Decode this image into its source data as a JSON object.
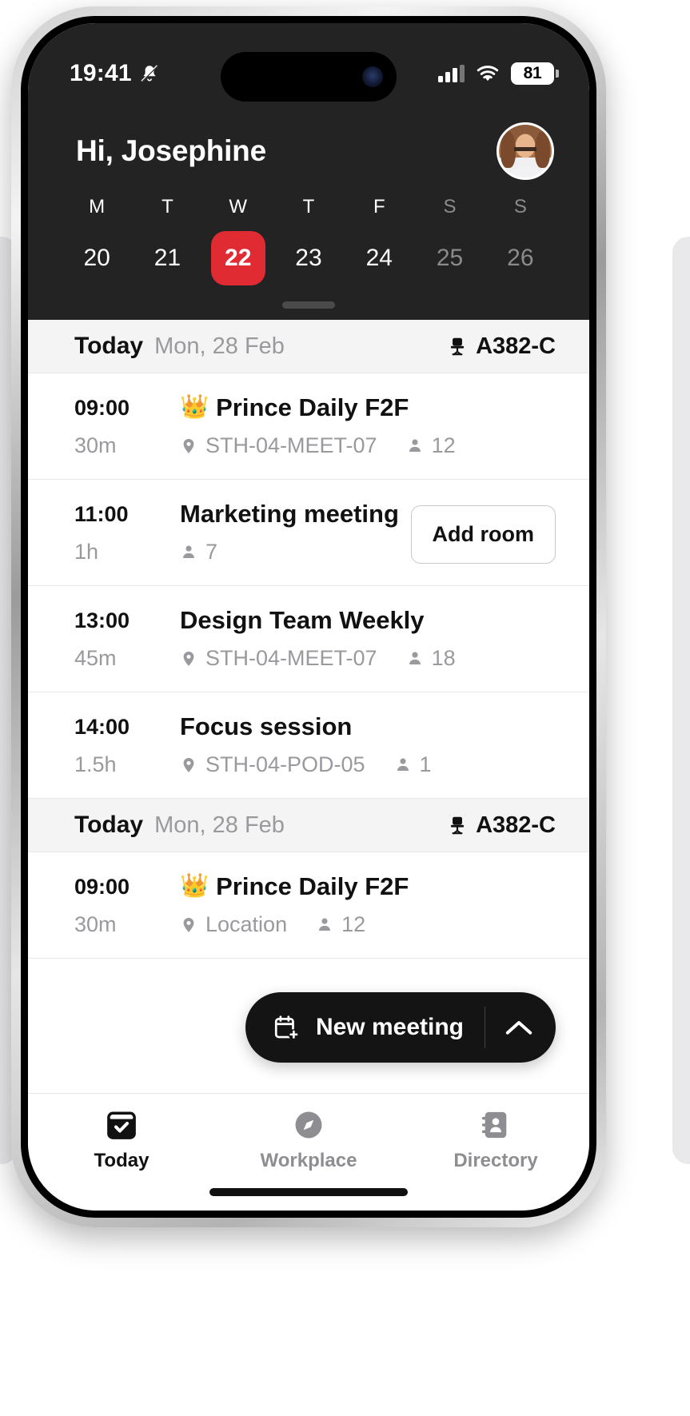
{
  "theme": {
    "accent": "#e02b33",
    "dark_bg": "#232323",
    "fab_bg": "#141414",
    "muted_text": "#9a9a9e"
  },
  "status_bar": {
    "time": "19:41",
    "bell_icon": "bell-muted-icon",
    "signal_icon": "cellular-signal-icon",
    "wifi_icon": "wifi-icon",
    "battery_level": "81"
  },
  "header": {
    "greeting": "Hi, Josephine",
    "avatar_icon": "user-avatar",
    "week": [
      {
        "letter": "M",
        "date": "20",
        "state": "normal"
      },
      {
        "letter": "T",
        "date": "21",
        "state": "normal"
      },
      {
        "letter": "W",
        "date": "22",
        "state": "today"
      },
      {
        "letter": "T",
        "date": "23",
        "state": "normal"
      },
      {
        "letter": "F",
        "date": "24",
        "state": "normal"
      },
      {
        "letter": "S",
        "date": "25",
        "state": "dim"
      },
      {
        "letter": "S",
        "date": "26",
        "state": "dim"
      }
    ]
  },
  "sections": [
    {
      "today_label": "Today",
      "date_label": "Mon, 28 Feb",
      "desk_icon": "office-chair-icon",
      "desk_code": "A382-C",
      "events": [
        {
          "start": "09:00",
          "duration": "30m",
          "emoji": "👑",
          "title": "Prince Daily F2F",
          "location_icon": "location-pin-icon",
          "location": "STH-04-MEET-07",
          "attendee_icon": "person-icon",
          "attendees": "12",
          "action": null
        },
        {
          "start": "11:00",
          "duration": "1h",
          "emoji": "",
          "title": "Marketing meeting",
          "location_icon": "",
          "location": "",
          "attendee_icon": "person-icon",
          "attendees": "7",
          "action": "Add room"
        },
        {
          "start": "13:00",
          "duration": "45m",
          "emoji": "",
          "title": "Design Team Weekly",
          "location_icon": "location-pin-icon",
          "location": "STH-04-MEET-07",
          "attendee_icon": "person-icon",
          "attendees": "18",
          "action": null
        },
        {
          "start": "14:00",
          "duration": "1.5h",
          "emoji": "",
          "title": "Focus session",
          "location_icon": "location-pin-icon",
          "location": "STH-04-POD-05",
          "attendee_icon": "person-icon",
          "attendees": "1",
          "action": null
        }
      ]
    },
    {
      "today_label": "Today",
      "date_label": "Mon, 28 Feb",
      "desk_icon": "office-chair-icon",
      "desk_code": "A382-C",
      "events": [
        {
          "start": "09:00",
          "duration": "30m",
          "emoji": "👑",
          "title": "Prince Daily F2F",
          "location_icon": "location-pin-icon",
          "location": "Location",
          "attendee_icon": "person-icon",
          "attendees": "12",
          "action": null
        }
      ]
    }
  ],
  "fab": {
    "icon": "calendar-plus-icon",
    "label": "New meeting",
    "expand_icon": "chevron-up-icon"
  },
  "tabbar": [
    {
      "icon": "calendar-check-icon",
      "label": "Today",
      "active": true
    },
    {
      "icon": "compass-icon",
      "label": "Workplace",
      "active": false
    },
    {
      "icon": "contact-book-icon",
      "label": "Directory",
      "active": false
    }
  ]
}
